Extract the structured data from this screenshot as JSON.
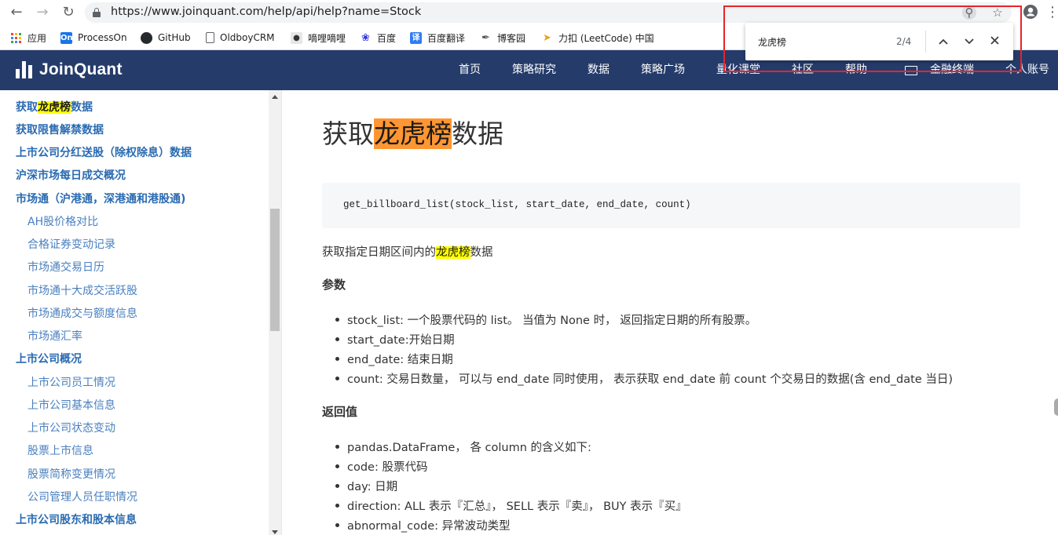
{
  "browser": {
    "url": "https://www.joinquant.com/help/api/help?name=Stock",
    "bookmarks": [
      {
        "label": "应用",
        "icon": "apps-grid-icon"
      },
      {
        "label": "ProcessOn",
        "icon": "processon-icon"
      },
      {
        "label": "GitHub",
        "icon": "github-icon"
      },
      {
        "label": "OldboyCRM",
        "icon": "page-icon"
      },
      {
        "label": "嘀哩嘀哩",
        "icon": "dilidili-icon"
      },
      {
        "label": "百度",
        "icon": "baidu-paw-icon"
      },
      {
        "label": "百度翻译",
        "icon": "baidu-translate-icon"
      },
      {
        "label": "博客园",
        "icon": "cnblogs-icon"
      },
      {
        "label": "力扣 (LeetCode) 中国",
        "icon": "leetcode-icon"
      }
    ]
  },
  "find_bar": {
    "query": "龙虎榜",
    "count": "2/4"
  },
  "site": {
    "brand": "JoinQuant",
    "nav": [
      "首页",
      "策略研究",
      "数据",
      "策略广场",
      "量化课堂",
      "社区",
      "帮助",
      "金融终端",
      "个人账号"
    ]
  },
  "sidebar": {
    "items": [
      {
        "level": 1,
        "pre": "获取",
        "hl": "龙虎榜",
        "post": "数据"
      },
      {
        "level": 1,
        "text": "获取限售解禁数据"
      },
      {
        "level": 1,
        "text": "上市公司分红送股（除权除息）数据"
      },
      {
        "level": 1,
        "text": "沪深市场每日成交概况"
      },
      {
        "level": 1,
        "text": "市场通（沪港通，深港通和港股通)"
      },
      {
        "level": 2,
        "text": "AH股价格对比"
      },
      {
        "level": 2,
        "text": "合格证券变动记录"
      },
      {
        "level": 2,
        "text": "市场通交易日历"
      },
      {
        "level": 2,
        "text": "市场通十大成交活跃股"
      },
      {
        "level": 2,
        "text": "市场通成交与额度信息"
      },
      {
        "level": 2,
        "text": "市场通汇率"
      },
      {
        "level": 1,
        "text": "上市公司概况"
      },
      {
        "level": 2,
        "text": "上市公司员工情况"
      },
      {
        "level": 2,
        "text": "上市公司基本信息"
      },
      {
        "level": 2,
        "text": "上市公司状态变动"
      },
      {
        "level": 2,
        "text": "股票上市信息"
      },
      {
        "level": 2,
        "text": "股票简称变更情况"
      },
      {
        "level": 2,
        "text": "公司管理人员任职情况"
      },
      {
        "level": 1,
        "text": "上市公司股东和股本信息"
      }
    ]
  },
  "content": {
    "title_pre": "获取",
    "title_hl": "龙虎榜",
    "title_post": "数据",
    "code": "get_billboard_list(stock_list, start_date, end_date, count)",
    "desc_pre": "获取指定日期区间内的",
    "desc_hl": "龙虎榜",
    "desc_post": "数据",
    "params_heading": "参数",
    "params": [
      "stock_list: 一个股票代码的 list。 当值为 None 时， 返回指定日期的所有股票。",
      "start_date:开始日期",
      "end_date: 结束日期",
      "count: 交易日数量， 可以与 end_date 同时使用， 表示获取 end_date 前 count 个交易日的数据(含 end_date 当日)"
    ],
    "returns_heading": "返回值",
    "returns": [
      "pandas.DataFrame， 各 column 的含义如下:",
      "code: 股票代码",
      "day: 日期",
      "direction: ALL 表示『汇总』， SELL 表示『卖』， BUY 表示『买』",
      "abnormal_code: 异常波动类型"
    ]
  },
  "colors": {
    "header_bg": "#253c6b",
    "sidebar_link": "#2a6bb1",
    "find_highlight_active": "#ff9632",
    "find_highlight": "#ffff00",
    "annotation_red": "#e8242a"
  }
}
